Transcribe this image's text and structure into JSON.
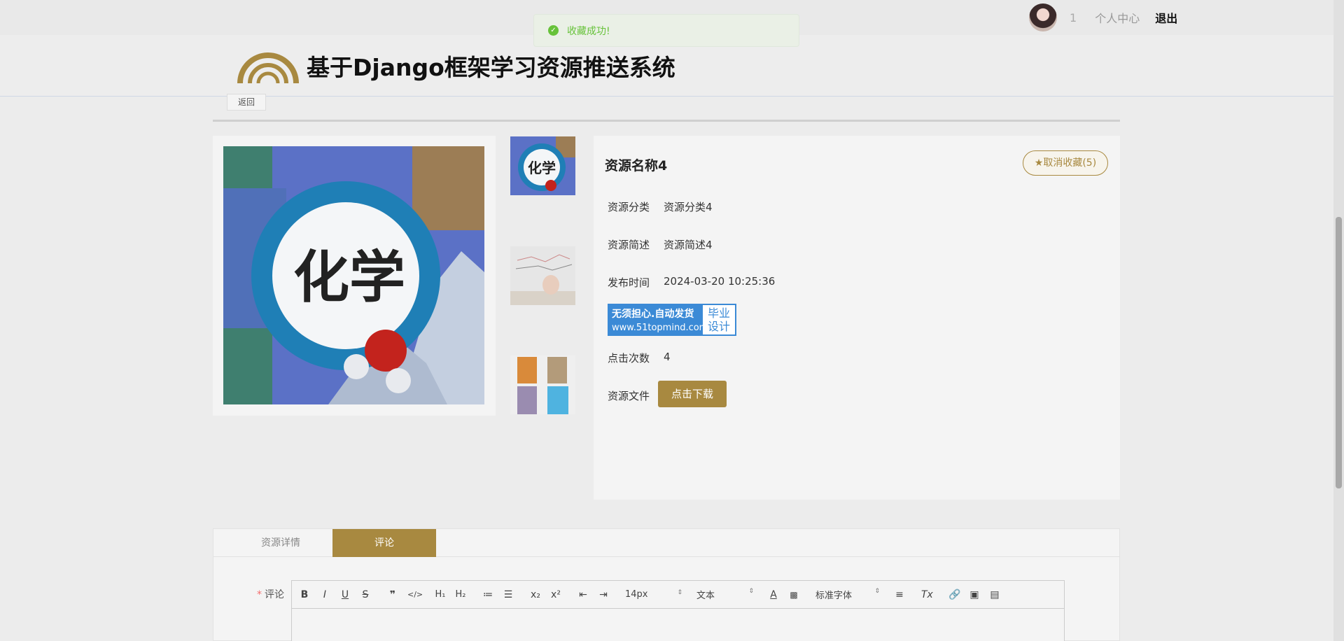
{
  "toast": {
    "text": "收藏成功!"
  },
  "user": {
    "count": "1",
    "user_center": "个人中心",
    "logout": "退出"
  },
  "header": {
    "title": "基于Django框架学习资源推送系统"
  },
  "back": "返回",
  "resource": {
    "name": "资源名称4",
    "fav_button": "★取消收藏(5)",
    "fields": [
      {
        "label": "资源分类",
        "value": "资源分类4"
      },
      {
        "label": "资源简述",
        "value": "资源简述4"
      },
      {
        "label": "发布时间",
        "value": "2024-03-20 10:25:36"
      },
      {
        "label": "点击次数",
        "value": "4"
      },
      {
        "label": "资源文件",
        "value": "点击下载"
      }
    ],
    "ad": {
      "line1": "无须担心.自动发货",
      "line2": "www.51topmind.com",
      "right1": "毕业",
      "right2": "设计"
    }
  },
  "tabs": [
    {
      "label": "资源详情"
    },
    {
      "label": "评论"
    }
  ],
  "comment": {
    "required_mark": "*",
    "label": "评论"
  },
  "toolbar": {
    "font_size": "14px",
    "block_type": "文本",
    "font_family": "标准字体"
  },
  "colors": {
    "accent": "#a88940",
    "success": "#67c23a"
  }
}
